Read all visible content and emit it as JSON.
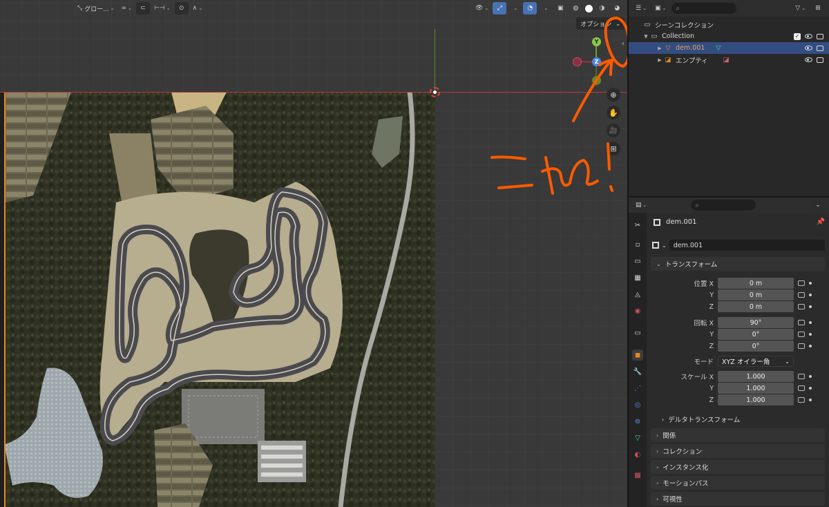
{
  "viewport": {
    "header": {
      "transform_orientation": "グロー...",
      "options_label": "オプション"
    },
    "gizmo": {
      "y_label": "Y",
      "z_label": "Z"
    },
    "annotation": {
      "handwritten_text": "これ!"
    }
  },
  "outliner": {
    "scene_collection_label": "シーンコレクション",
    "items": [
      {
        "label": "Collection"
      },
      {
        "label": "dem.001"
      },
      {
        "label": "エンプティ"
      }
    ]
  },
  "properties": {
    "object_name": "dem.001",
    "object_field": "dem.001",
    "transform_panel": "トランスフォーム",
    "location": {
      "label": "位置 X",
      "x": "0 m",
      "y_label": "Y",
      "y": "0 m",
      "z_label": "Z",
      "z": "0 m"
    },
    "rotation": {
      "label": "回転 X",
      "x": "90°",
      "y_label": "Y",
      "y": "0°",
      "z_label": "Z",
      "z": "0°"
    },
    "mode": {
      "label": "モード",
      "value": "XYZ オイラー角"
    },
    "scale": {
      "label": "スケール X",
      "x": "1.000",
      "y_label": "Y",
      "y": "1.000",
      "z_label": "Z",
      "z": "1.000"
    },
    "delta_transform": "デルタトランスフォーム",
    "panels": [
      "関係",
      "コレクション",
      "インスタンス化",
      "モーションパス",
      "可視性"
    ]
  },
  "colors": {
    "accent_blue": "#4772b3",
    "selection_row": "#334d80",
    "annotation_orange": "#ff5a00",
    "object_orange": "#e58a1f"
  }
}
